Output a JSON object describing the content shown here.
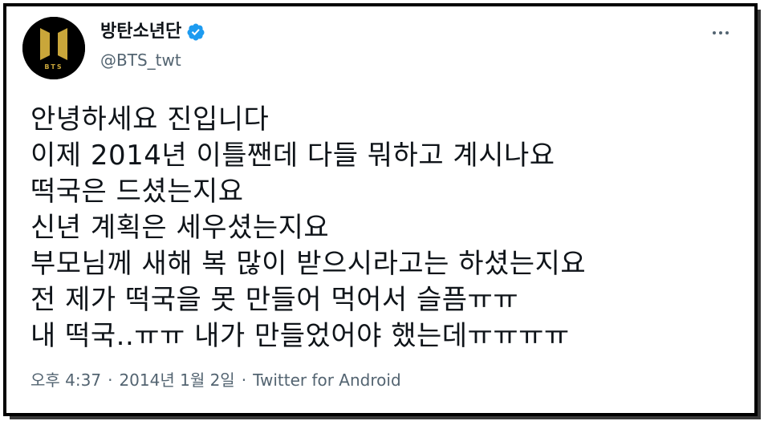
{
  "tweet": {
    "author": {
      "display_name": "방탄소년단",
      "handle": "@BTS_twt",
      "avatar_text": "BTS",
      "verified": true,
      "verified_icon": "verified-badge-icon"
    },
    "more_icon": "more-options-icon",
    "lines": [
      "안녕하세요 진입니다",
      "이제 2014년 이틀짼데 다들 뭐하고 계시나요",
      "떡국은 드셨는지요",
      "신년 계획은 세우셨는지요",
      "부모님께 새해 복 많이 받으시라고는 하셨는지요",
      "전 제가 떡국을 못 만들어 먹어서 슬픔ㅠㅠ",
      "내 떡국..ㅠㅠ 내가 만들었어야 했는데ㅠㅠㅠㅠ"
    ],
    "time": "오후 4:37",
    "date": "2014년 1월 2일",
    "source": "Twitter for Android",
    "separator": "·"
  },
  "colors": {
    "text_primary": "#0f1419",
    "text_secondary": "#536471",
    "verified_blue": "#1d9bf0",
    "logo_gold": "#c9a63a",
    "frame": "#000000"
  }
}
